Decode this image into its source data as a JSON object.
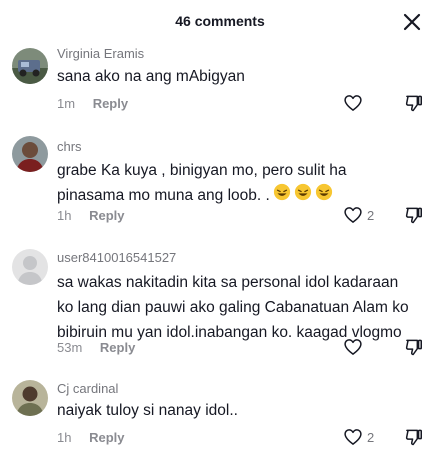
{
  "header": {
    "title": "46 comments",
    "close_icon": "close-icon"
  },
  "comments": [
    {
      "username": "Virginia Eramis",
      "text": "sana ako na ang mAbigyan",
      "time": "1m",
      "reply_label": "Reply",
      "likes": "",
      "avatar": "photo-avatar-truck"
    },
    {
      "username": "chrs",
      "text_line1": "grabe Ka kuya , binigyan mo, pero sulit ha",
      "text_line2": "pinasama mo muna ang loob. .",
      "emojis": [
        "laughing-emoji",
        "laughing-emoji",
        "laughing-emoji"
      ],
      "time": "1h",
      "reply_label": "Reply",
      "likes": "2",
      "avatar": "photo-avatar-person"
    },
    {
      "username": "user8410016541527",
      "text_line1": "sa wakas nakitadin kita sa personal idol kadaraan",
      "text_line2": "ko lang dian pauwi ako galing Cabanatuan Alam ko",
      "text_line3": "bibiruin mu yan idol.inabangan ko. kaagad vlogmo",
      "time": "53m",
      "reply_label": "Reply",
      "likes": "",
      "avatar": "default-avatar"
    },
    {
      "username": "Cj cardinal",
      "text": "naiyak tuloy si nanay idol..",
      "time": "1h",
      "reply_label": "Reply",
      "likes": "2",
      "avatar": "photo-avatar-person"
    }
  ],
  "colors": {
    "text": "#161823",
    "secondary": "#75767c",
    "emoji_yellow": "#f7c631"
  }
}
